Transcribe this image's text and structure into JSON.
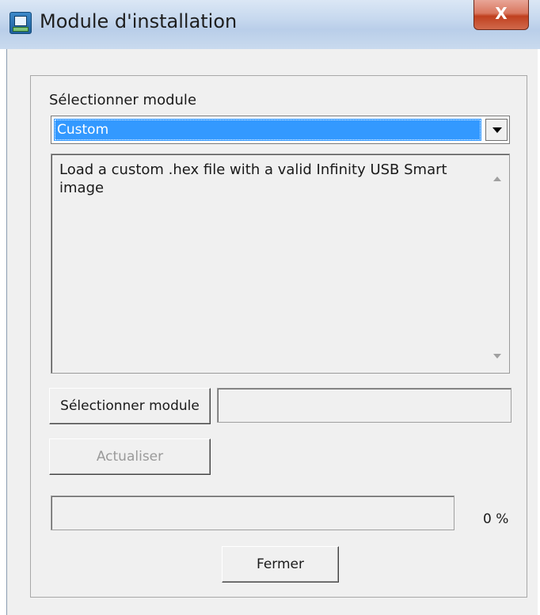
{
  "window": {
    "title": "Module d'installation",
    "close_label": "X"
  },
  "module_select": {
    "label": "Sélectionner module",
    "selected": "Custom"
  },
  "description": {
    "text": "Load a custom .hex file with a valid Infinity USB Smart image"
  },
  "buttons": {
    "select_module": "Sélectionner module",
    "refresh": "Actualiser",
    "close": "Fermer"
  },
  "file_path": {
    "value": ""
  },
  "progress": {
    "value": 0,
    "label": "0 %"
  }
}
